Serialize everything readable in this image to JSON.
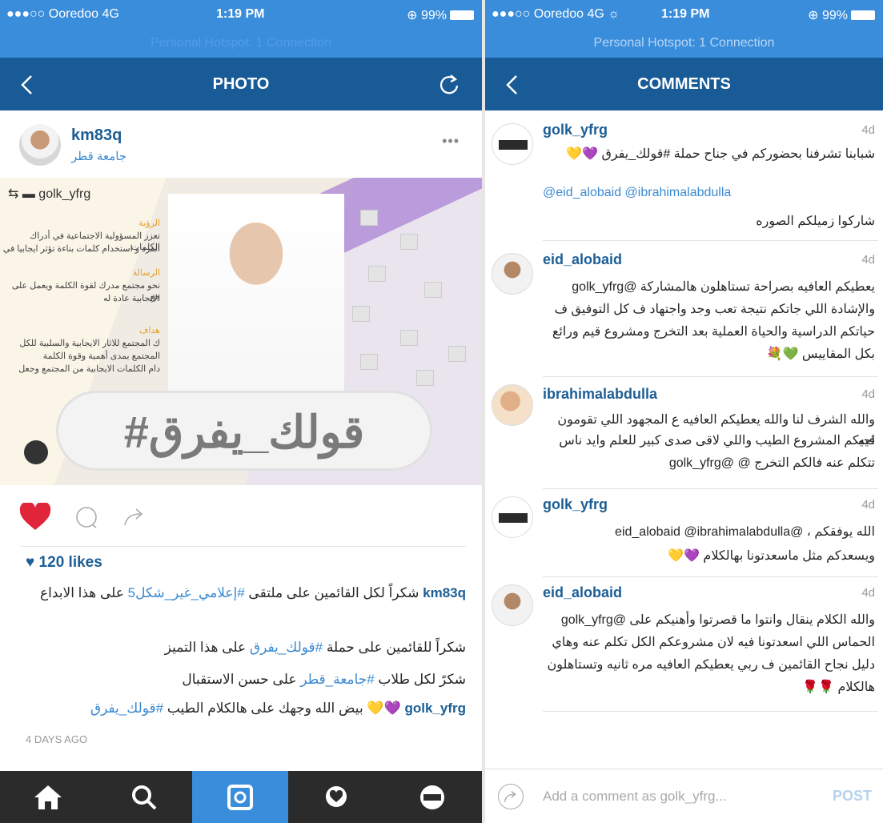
{
  "left": {
    "status": {
      "carrier": "●●●○○ Ooredoo  4G",
      "time": "1:19 PM",
      "battery": "⊕ 99%"
    },
    "hotspot": "Personal Hotspot: 1 Connection",
    "nav": {
      "title": "PHOTO"
    },
    "post": {
      "username": "km83q",
      "location": "جامعة قطر",
      "more": "•••",
      "photo": {
        "repost_user": "golk_yfrg",
        "overlay_hashtag": "#قولك_يفرق",
        "texts": [
          "الرؤية",
          "تعزز المسؤولية الاجتماعية في أدراك الكلمات",
          "الفرد و استخدام كلمات بناءة تؤثر ايجابيا في",
          "الرسالة",
          "نحو مجتمع مدرك لقوة الكلمة ويعمل على جع",
          "الايجابية عادة له",
          "هداف",
          "ك المجتمع للاثار الايجابية والسلبية للكل",
          "المجتمع بمدى أهمية وقوة الكلمة",
          "دام الكلمات الايجابية من المجتمع وجعل"
        ]
      },
      "likes": "♥ 120 likes",
      "caption": [
        {
          "user": "km83q",
          "text": "شكراً لكل القائمين على ملتقى ",
          "hashtag": "#إعلامي_غير_شكل5",
          "after": " على هذا الابداع"
        },
        {
          "text": "شكراً للقائمين على حملة ",
          "hashtag": "#قولك_يفرق",
          "after": " على هذا التميز"
        },
        {
          "text": "شكرً لكل طلاب ",
          "hashtag": "#جامعة_قطر",
          "after": " على حسن الاستقبال"
        },
        {
          "user": "golk_yfrg",
          "text": "💜💛 بيض الله وجهك على هالكلام الطيب ",
          "hashtag": "#قولك_يفرق",
          "after": ""
        }
      ],
      "time_ago": "4 DAYS AGO"
    },
    "tabs": [
      "home",
      "search",
      "camera",
      "activity",
      "profile"
    ]
  },
  "right": {
    "status": {
      "carrier": "●●●○○ Ooredoo  4G ☼",
      "time": "1:19 PM",
      "battery": "⊕ 99%"
    },
    "hotspot": "Personal Hotspot: 1 Connection",
    "nav": {
      "title": "COMMENTS"
    },
    "comments": [
      {
        "user": "golk_yfrg",
        "time": "4d",
        "lines": [
          "شبابنا تشرفنا بحضوركم في جناح حملة #قولك_يفرق 💜💛",
          "@eid_alobaid @ibrahimalabdulla",
          "شاركوا زميلكم الصوره"
        ]
      },
      {
        "user": "eid_alobaid",
        "time": "4d",
        "lines": [
          "يعطيكم العافيه بصراحة تستاهلون هالمشاركة @golk_yfrg",
          "والإشادة اللي جاتكم نتيجة تعب وجد واجتهاد ف كل التوفيق ف",
          "حياتكم الدراسية والحياة العملية بعد التخرج ومشروع قيم ورائع",
          "بكل المقاييس 💚💐"
        ]
      },
      {
        "user": "ibrahimalabdulla",
        "time": "4d",
        "lines": [
          "والله الشرف لنا والله يعطيكم العافيه ع المجهود اللي تقومون فيه",
          "احيكم المشروع الطيب واللي لاقى صدى كبير للعلم وايد ناس",
          "تتكلم عنه فالكم التخرج @ @golk_yfrg"
        ]
      },
      {
        "user": "golk_yfrg",
        "time": "4d",
        "lines": [
          "الله يوفقكم ، @eid_alobaid @ibrahimalabdulla",
          "ويسعدكم مثل ماسعدتونا بهالكلام 💜💛"
        ]
      },
      {
        "user": "eid_alobaid",
        "time": "4d",
        "lines": [
          "والله الكلام ينقال وانتوا ما قصرتوا وأهنيكم على @golk_yfrg",
          "الحماس اللي اسعدتونا فيه لان مشروعكم الكل تكلم عنه وهاي",
          "دليل نجاح القائمين ف ربي يعطيكم العافيه مره ثانيه وتستاهلون",
          "هالكلام 🌹🌹"
        ]
      }
    ],
    "input": {
      "placeholder": "Add a comment as golk_yfrg...",
      "post": "POST"
    }
  },
  "colors": {
    "blue": "#3a8ddb",
    "navy": "#195b96",
    "link": "#1c5e95",
    "heart": "#e0243a"
  }
}
